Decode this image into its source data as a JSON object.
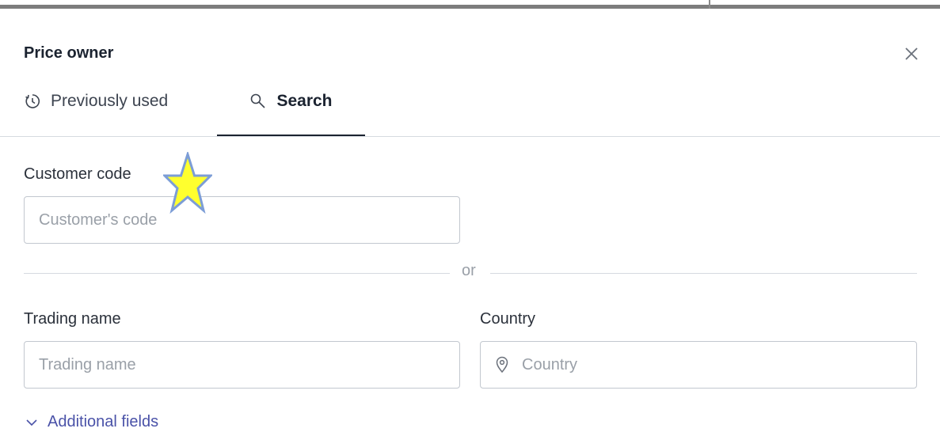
{
  "dialog": {
    "title": "Price owner",
    "close_icon": "close-icon"
  },
  "tabs": [
    {
      "label": "Previously used",
      "icon": "history-icon",
      "active": false
    },
    {
      "label": "Search",
      "icon": "search-icon",
      "active": true
    }
  ],
  "customer_code": {
    "label": "Customer code",
    "placeholder": "Customer's code",
    "value": ""
  },
  "divider": {
    "text": "or"
  },
  "trading_name": {
    "label": "Trading name",
    "placeholder": "Trading name",
    "value": ""
  },
  "country": {
    "label": "Country",
    "placeholder": "Country",
    "icon": "location-pin-icon",
    "value": ""
  },
  "additional_fields": {
    "label": "Additional fields",
    "icon": "chevron-down-icon"
  },
  "colors": {
    "accent": "#1b2330",
    "link": "#4a52a8",
    "star_fill": "#ffff2e",
    "star_stroke": "#7c9dd6"
  }
}
